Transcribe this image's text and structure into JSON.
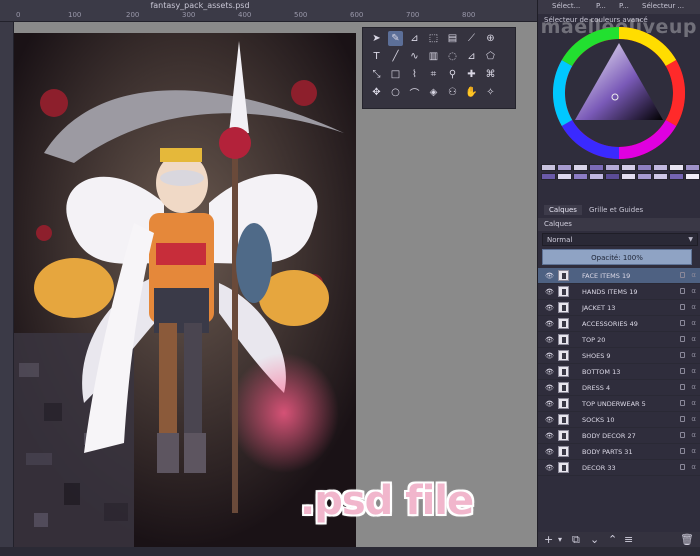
{
  "document": {
    "title": "fantasy_pack_assets.psd"
  },
  "rulers": {
    "top_numbers": [
      "0",
      "100",
      "200",
      "300",
      "400",
      "500",
      "600",
      "700",
      "800"
    ]
  },
  "dock": {
    "tabs": [
      "Sélect...",
      "P...",
      "P...",
      "Sélecteur ..."
    ],
    "color_selector_title": "Sélecteur de couleurs avancé",
    "watermark": "maelleoliveup"
  },
  "layers_panel": {
    "tabs": [
      "Calques",
      "Grille et Guides"
    ],
    "title": "Calques",
    "blend_mode": "Normal",
    "opacity_label": "Opacité:  100%",
    "layers": [
      {
        "name": "FACE ITEMS 19",
        "selected": true
      },
      {
        "name": "HANDS ITEMS 19",
        "selected": false
      },
      {
        "name": "JACKET 13",
        "selected": false
      },
      {
        "name": "ACCESSORIES 49",
        "selected": false
      },
      {
        "name": "TOP 20",
        "selected": false
      },
      {
        "name": "SHOES 9",
        "selected": false
      },
      {
        "name": "BOTTOM 13",
        "selected": false
      },
      {
        "name": "DRESS 4",
        "selected": false
      },
      {
        "name": "TOP UNDERWEAR 5",
        "selected": false
      },
      {
        "name": "SOCKS 10",
        "selected": false
      },
      {
        "name": "BODY DECOR 27",
        "selected": false
      },
      {
        "name": "BODY PARTS 31",
        "selected": false
      },
      {
        "name": "DECOR 33",
        "selected": false
      }
    ]
  },
  "overlay_text": ".psd file",
  "colors": {
    "accent": "#4e6182",
    "canvas_bg": "#8a8a8a",
    "panel_bg": "#2f2d3c"
  }
}
